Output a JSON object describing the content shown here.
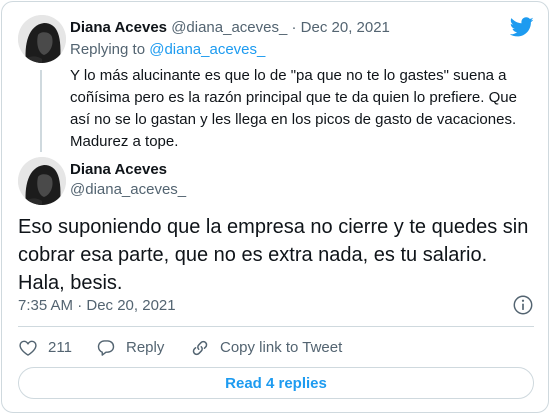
{
  "colors": {
    "accent": "#1d9bf0",
    "muted": "#536471",
    "text": "#0f1419",
    "border": "#cfd9de"
  },
  "reply_tweet": {
    "name": "Diana Aceves",
    "handle": "@diana_aceves_",
    "separator": "·",
    "date": "Dec 20, 2021",
    "replying_prefix": "Replying to",
    "replying_handle": "@diana_aceves_",
    "text": "Y lo más alucinante es que lo de \"pa que no te lo gastes\" suena a coñísima pero es la razón principal que te da quien lo prefiere. Que así no se lo gastan y les llega en los picos de gasto de vacaciones. Madurez a tope."
  },
  "main_tweet": {
    "name": "Diana Aceves",
    "handle": "@diana_aceves_",
    "text": "Eso suponiendo que la empresa no cierre y te quedes sin cobrar esa parte, que no es extra nada, es tu salario. Hala, besis.",
    "timestamp": "7:35 AM · Dec 20, 2021"
  },
  "actions": {
    "like_count": "211",
    "reply_label": "Reply",
    "copy_label": "Copy link to Tweet"
  },
  "read_replies_label": "Read 4 replies",
  "icons": [
    "twitter-logo-icon",
    "info-icon",
    "heart-icon",
    "reply-icon",
    "link-icon"
  ]
}
